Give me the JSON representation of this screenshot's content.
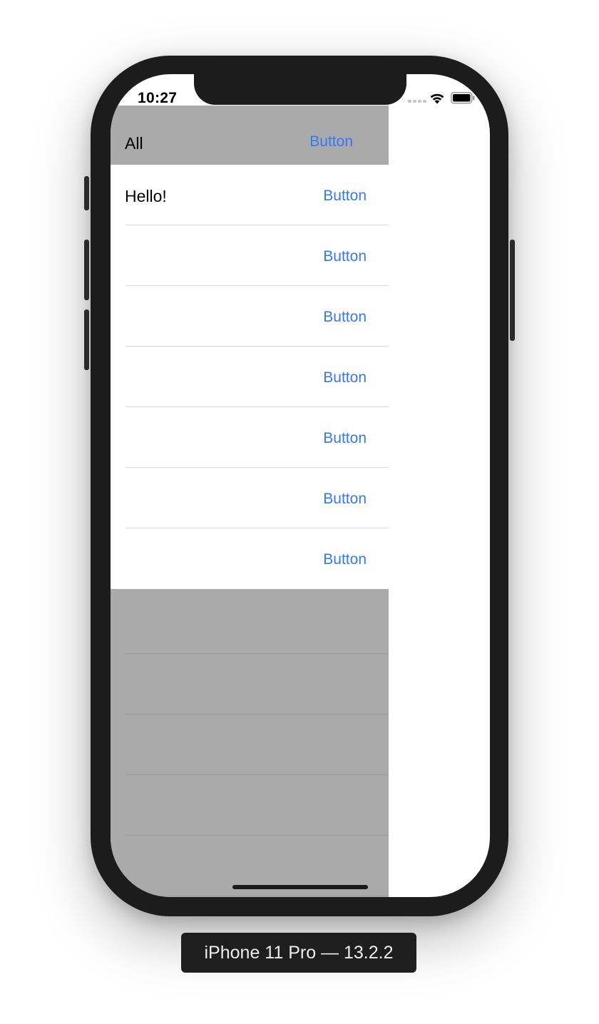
{
  "status_bar": {
    "time": "10:27",
    "icons": [
      "signal-dots-icon",
      "wifi-icon",
      "battery-icon"
    ]
  },
  "header": {
    "title": "All",
    "button_label": "Button",
    "background": "#aaaaaa"
  },
  "rows": [
    {
      "label": "Hello!",
      "button_label": "Button"
    },
    {
      "label": "",
      "button_label": "Button"
    },
    {
      "label": "",
      "button_label": "Button"
    },
    {
      "label": "",
      "button_label": "Button"
    },
    {
      "label": "",
      "button_label": "Button"
    },
    {
      "label": "",
      "button_label": "Button"
    },
    {
      "label": "",
      "button_label": "Button"
    }
  ],
  "device_label": "iPhone 11 Pro — 13.2.2",
  "colors": {
    "accent": "#3478f6",
    "list_background": "#aaaaaa",
    "frame": "#1c1c1c"
  }
}
